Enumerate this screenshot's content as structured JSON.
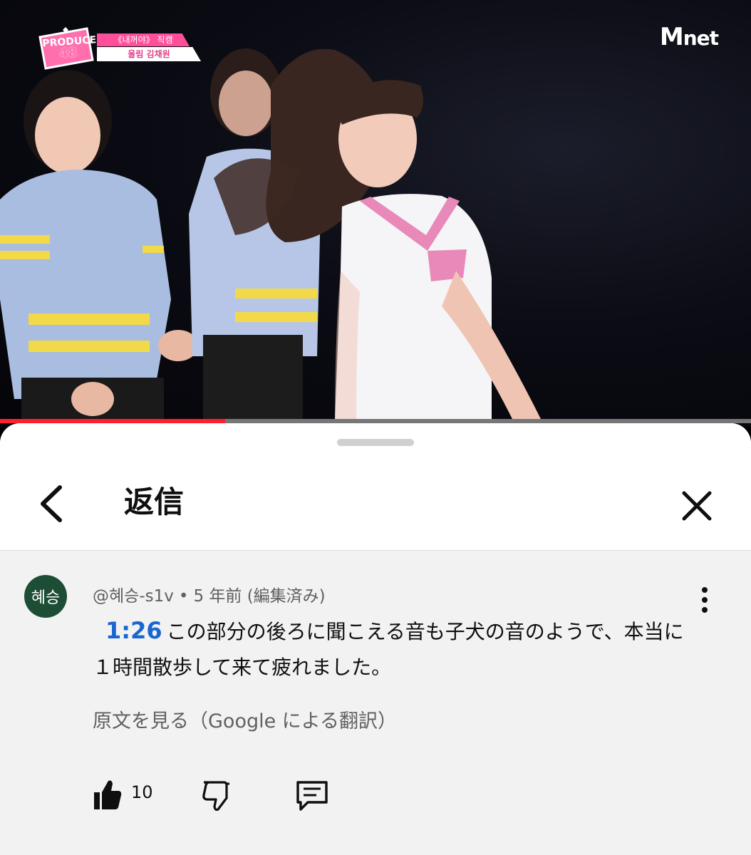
{
  "video": {
    "overlay_brand_line1": "PRODUCE",
    "overlay_brand_line2": "48",
    "caption_line1": "《내꺼야》 직캠",
    "caption_line2": "울림 김채원",
    "channel_logo_m": "M",
    "channel_logo_rest": "net",
    "progress_fraction": 0.3,
    "progress_color": "#ff1f2e"
  },
  "sheet": {
    "title": "返信",
    "back_icon": "chevron-left-icon",
    "close_icon": "close-icon"
  },
  "comment": {
    "avatar_text": "혜승",
    "avatar_color": "#1e4d36",
    "author": "@혜승-s1v",
    "separator": "•",
    "age": "5 年前",
    "edited": "(編集済み)",
    "timestamp": "1:26",
    "timestamp_color": "#1a66d0",
    "body": "この部分の後ろに聞こえる音も子犬の音のようで、本当に１時間散歩して来て疲れました。",
    "see_original": "原文を見る（Google による翻訳）",
    "like_count": "10",
    "icons": [
      "thumbs-up-icon",
      "thumbs-down-icon",
      "reply-icon",
      "more-vert-icon"
    ]
  }
}
